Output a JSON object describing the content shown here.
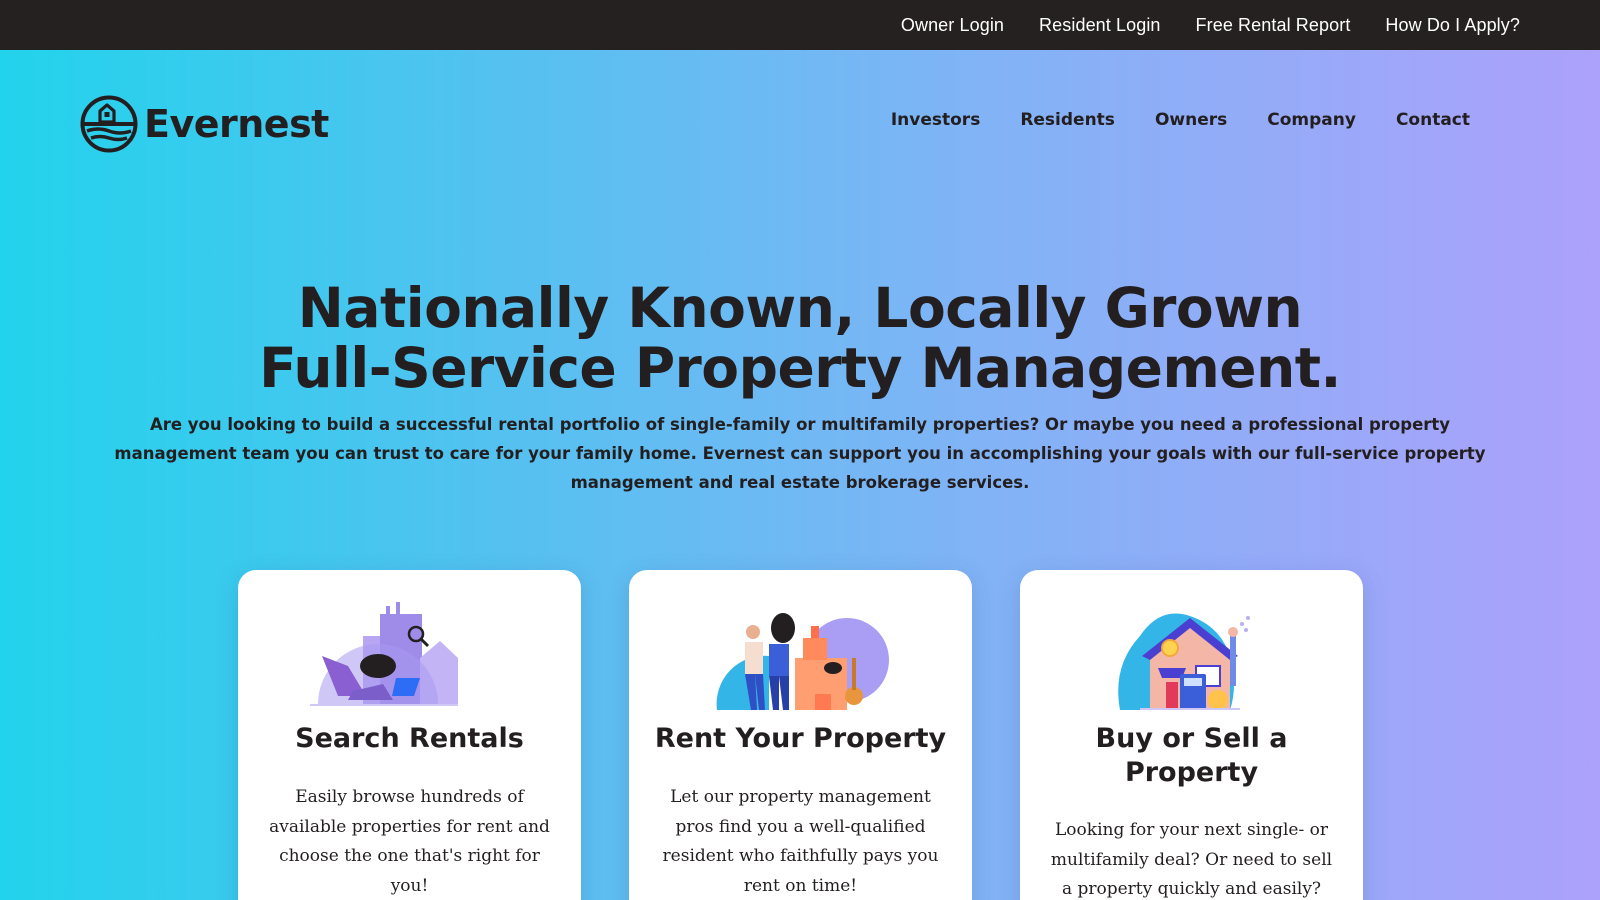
{
  "topbar": {
    "links": [
      "Owner Login",
      "Resident Login",
      "Free Rental Report",
      "How Do I Apply?"
    ]
  },
  "brand": {
    "name": "Evernest"
  },
  "nav": {
    "items": [
      "Investors",
      "Residents",
      "Owners",
      "Company",
      "Contact"
    ]
  },
  "hero": {
    "title_line1": "Nationally Known, Locally Grown",
    "title_line2": "Full-Service Property Management.",
    "subtitle": "Are you looking to build a successful rental portfolio of single-family or multifamily properties? Or maybe you need a professional property management team you can trust to care for your family home. Evernest can support you in accomplishing your goals with our full-service property management and real estate brokerage services."
  },
  "cards": [
    {
      "title": "Search Rentals",
      "text": "Easily browse hundreds of available properties for rent and choose the one that's right for you!"
    },
    {
      "title": "Rent Your Property",
      "text": "Let our property management pros find you a well-qualified resident who faithfully pays you rent on time!"
    },
    {
      "title": "Buy or Sell a Property",
      "text": "Looking for your next single- or multifamily deal? Or need to sell a property quickly and easily?"
    }
  ],
  "colors": {
    "topbar_bg": "#252120",
    "text_dark": "#231f20",
    "gradient_start": "#22d3ec",
    "gradient_end": "#aca1fb",
    "card_bg": "#ffffff"
  },
  "icons": [
    "evernest-logo-icon",
    "search-rentals-illustration",
    "rent-property-illustration",
    "buy-sell-house-illustration"
  ]
}
